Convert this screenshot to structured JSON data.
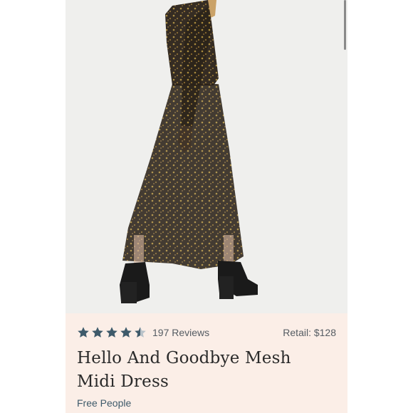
{
  "listing": {
    "rating": 4.5,
    "rating_max": 5,
    "reviews_text": "197 Reviews",
    "retail_text": "Retail: $128",
    "title": "Hello And Goodbye Mesh Midi Dress",
    "brand": "Free People"
  },
  "colors": {
    "star": "#3e5a6a",
    "star_empty": "#b8c2c9",
    "info_bg": "#fbeee7",
    "photo_bg": "#efefed"
  },
  "icons": {
    "star": "star-icon",
    "half_star": "half-star-icon"
  }
}
